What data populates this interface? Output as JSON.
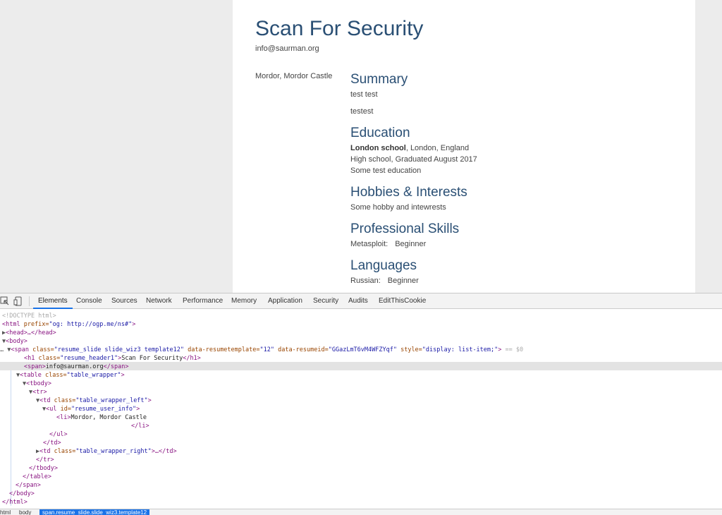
{
  "resume": {
    "name": "Scan For Security",
    "email": "info@saurman.org",
    "location": "Mordor, Mordor Castle",
    "summary": {
      "heading": "Summary",
      "lines": [
        "test test",
        "testest"
      ]
    },
    "education": {
      "heading": "Education",
      "school": "London school",
      "school_loc": ", London, England",
      "line2": "High school, Graduated August 2017",
      "line3": "Some test education"
    },
    "hobbies": {
      "heading": "Hobbies & Interests",
      "text": "Some hobby and intewrests"
    },
    "skills": {
      "heading": "Professional Skills",
      "name": "Metasploit:",
      "level": "Beginner"
    },
    "languages": {
      "heading": "Languages",
      "name": "Russian:",
      "level": "Beginner"
    }
  },
  "devtools": {
    "tabs": [
      "Elements",
      "Console",
      "Sources",
      "Network",
      "Performance",
      "Memory",
      "Application",
      "Security",
      "Audits",
      "EditThisCookie"
    ],
    "active_tab": "Elements",
    "dom": {
      "doctype": "<!DOCTYPE html>",
      "html_open": "<html",
      "html_attr": " prefix=",
      "html_val": "\"og: http://ogp.me/ns#\"",
      "html_close": ">",
      "head": "<head>…</head>",
      "body_open": "<body>",
      "span_tag": "<span",
      "span_attr1": " class=",
      "span_val1": "\"resume_slide slide_wiz3 template12\"",
      "span_attr2": " data-resumetemplate=",
      "span_val2": "\"12\"",
      "span_attr3": " data-resumeid=",
      "span_val3": "\"GGazLmT6vM4WFZYqf\"",
      "span_attr4": " style=",
      "span_val4": "\"display: list-item;\"",
      "span_end": ">",
      "span_eq": " == $0",
      "h1_open": "<h1",
      "h1_attr": " class=",
      "h1_val": "\"resume_header1\"",
      "h1_gt": ">",
      "h1_text": "Scan For Security",
      "h1_close": "</h1>",
      "inner_span_open": "<span>",
      "inner_span_text": "info@saurman.org",
      "inner_span_close": "</span>",
      "table_open": "<table",
      "table_attr": " class=",
      "table_val": "\"table_wrapper\"",
      "gt": ">",
      "tbody_open": "<tbody>",
      "tr_open": "<tr>",
      "td_open": "<td",
      "td_attr": " class=",
      "td_val": "\"table_wrapper_left\"",
      "ul_open": "<ul",
      "ul_attr": " id=",
      "ul_val": "\"resume_user_info\"",
      "li_open": "<li>",
      "li_text": "Mordor, Mordor Castle",
      "li_close": "</li>",
      "ul_close": "</ul>",
      "td_close": "</td>",
      "td2_val": "\"table_wrapper_right\"",
      "td2_rest": ">…</td>",
      "tr_close": "</tr>",
      "tbody_close": "</tbody>",
      "table_close": "</table>",
      "span_close": "</span>",
      "body_close": "</body>",
      "html_close_tag": "</html>"
    },
    "breadcrumbs": [
      "html",
      "body",
      "span.resume_slide.slide_wiz3.template12"
    ]
  }
}
